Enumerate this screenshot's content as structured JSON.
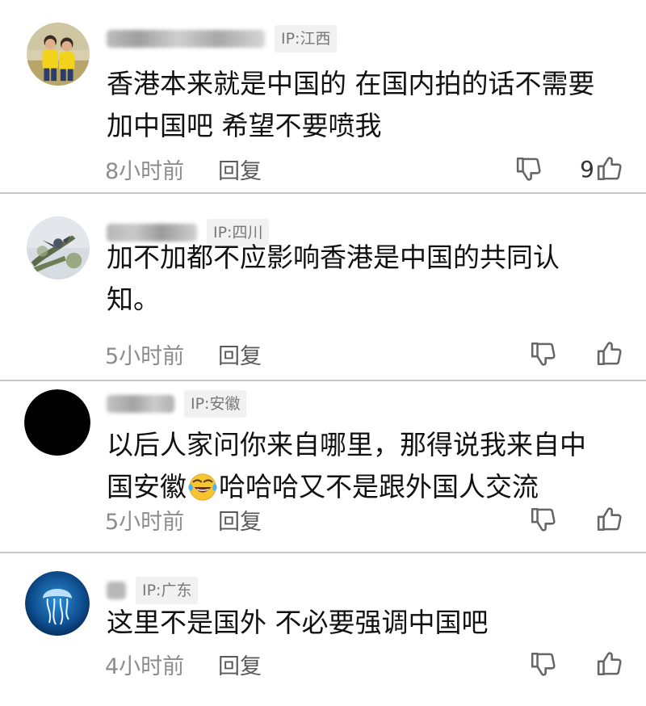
{
  "comments": [
    {
      "ip": "IP:江西",
      "lines": [
        "香港本来就是中国的 在国内拍的话不需要",
        "加中国吧 希望不要喷我"
      ],
      "time": "8小时前",
      "reply": "回复",
      "likes": "9",
      "avatar": "kids-photo"
    },
    {
      "ip": "IP:四川",
      "lines": [
        "加不加都不应影响香港是中国的共同认",
        "知。"
      ],
      "time": "5小时前",
      "reply": "回复",
      "likes": "",
      "avatar": "bird-on-branch"
    },
    {
      "ip": "IP:安徽",
      "line1": "以后人家问你来自哪里，那得说我来自中",
      "line2_before": "国安徽",
      "line2_after": "哈哈哈又不是跟外国人交流",
      "time": "5小时前",
      "reply": "回复",
      "likes": "",
      "avatar": "black-circle",
      "emoji": "laughing-crying-emoji"
    },
    {
      "ip": "IP:广东",
      "lines": [
        "这里不是国外  不必要强调中国吧"
      ],
      "time": "4小时前",
      "reply": "回复",
      "likes": "",
      "avatar": "blue-jellyfish"
    }
  ],
  "icons": {
    "dislike": "thumbs-down-icon",
    "like": "thumbs-up-icon"
  },
  "colors": {
    "text": "#111111",
    "meta": "#8d8d8d",
    "ip_badge_bg": "#f1f1f1",
    "divider": "#c9c9c9"
  }
}
